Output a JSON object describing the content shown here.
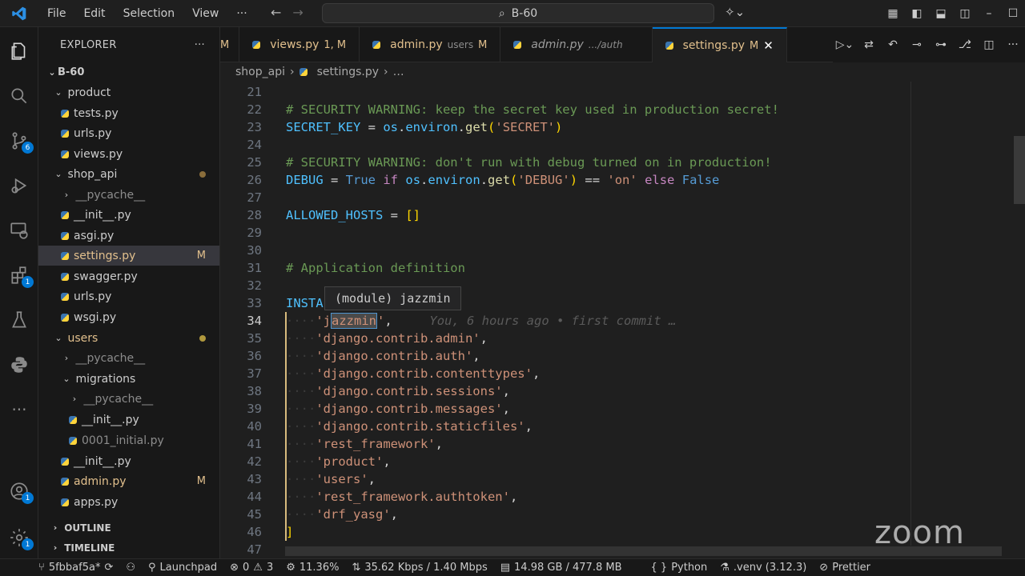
{
  "titlebar": {
    "menu": [
      "File",
      "Edit",
      "Selection",
      "View",
      "···"
    ],
    "search": "B-60"
  },
  "activity": {
    "scm_badge": "6",
    "extensions_badge": "1",
    "accounts_badge": "1",
    "settings_badge": "1"
  },
  "sidebar": {
    "title": "EXPLORER",
    "more": "···",
    "project": "B-60",
    "items": [
      {
        "label": "product",
        "kind": "folder"
      },
      {
        "label": "tests.py"
      },
      {
        "label": "urls.py"
      },
      {
        "label": "views.py"
      },
      {
        "label": "shop_api",
        "kind": "folder"
      },
      {
        "label": "__pycache__",
        "kind": "folder"
      },
      {
        "label": "__init__.py"
      },
      {
        "label": "asgi.py"
      },
      {
        "label": "settings.py",
        "status": "M"
      },
      {
        "label": "swagger.py"
      },
      {
        "label": "urls.py"
      },
      {
        "label": "wsgi.py"
      },
      {
        "label": "users",
        "kind": "folder"
      },
      {
        "label": "__pycache__",
        "kind": "folder"
      },
      {
        "label": "migrations",
        "kind": "folder"
      },
      {
        "label": "__pycache__",
        "kind": "folder"
      },
      {
        "label": "__init__.py"
      },
      {
        "label": "0001_initial.py"
      },
      {
        "label": "__init__.py"
      },
      {
        "label": "admin.py",
        "status": "M"
      },
      {
        "label": "apps.py"
      }
    ],
    "outline": "OUTLINE",
    "timeline": "TIMELINE"
  },
  "tabs": [
    {
      "label": "",
      "status": "M"
    },
    {
      "label": "views.py",
      "status": "1, M"
    },
    {
      "label": "admin.py",
      "desc": "users",
      "status": "M"
    },
    {
      "label": "admin.py",
      "desc": ".../auth",
      "status": ""
    },
    {
      "label": "settings.py",
      "status": "M"
    }
  ],
  "breadcrumb": {
    "folder": "shop_api",
    "file": "settings.py",
    "more": "…"
  },
  "editor": {
    "hover": "(module) jazzmin",
    "blame": "You, 6 hours ago • first commit …",
    "lines": [
      "21",
      "22",
      "23",
      "24",
      "25",
      "26",
      "27",
      "28",
      "29",
      "30",
      "31",
      "32",
      "33",
      "34",
      "35",
      "36",
      "37",
      "38",
      "39",
      "40",
      "41",
      "42",
      "43",
      "44",
      "45",
      "46",
      "47"
    ]
  },
  "statusbar": {
    "branch": "5fbbaf5a*",
    "launchpad": "Launchpad",
    "errors": "0",
    "warnings": "3",
    "cpu": "11.36%",
    "network": "35.62 Kbps / 1.40 Mbps",
    "memory": "14.98 GB / 477.8 MB",
    "language": "Python",
    "venv": ".venv (3.12.3)",
    "prettier": "Prettier"
  },
  "watermark": "zoom",
  "colors": {
    "accent": "#0078d4",
    "modified": "#e2c08d",
    "comment": "#6a9955",
    "string": "#ce9178",
    "keyword": "#569cd6"
  }
}
